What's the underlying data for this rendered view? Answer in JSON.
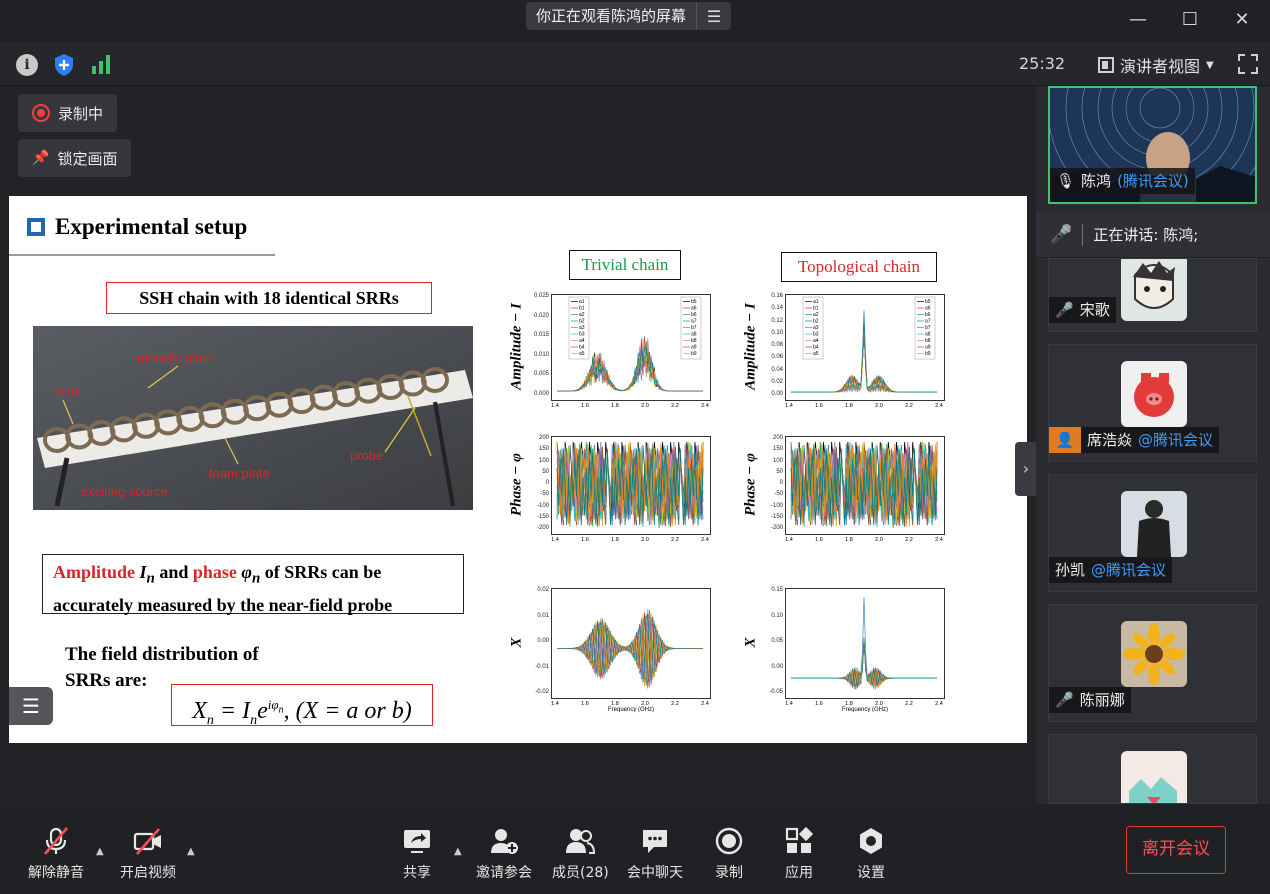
{
  "titlebar": {
    "share_status": "你正在观看陈鸿的屏幕",
    "menu_icon": "list-icon"
  },
  "statusbar": {
    "timer": "25:32",
    "view_mode": "演讲者视图"
  },
  "stage": {
    "recording_label": "录制中",
    "lock_label": "锁定画面"
  },
  "slide": {
    "title": "Experimental setup",
    "ssh_label": "SSH chain with 18 identical SRRs",
    "photo_labels": {
      "srr": "SRR",
      "metallic_plate": "metallic plate",
      "foam_plate": "foam plate",
      "probe": "probe",
      "exciting_source": "exciting source"
    },
    "measure_text": {
      "amplitude": "Amplitude",
      "amp_sym": "I",
      "amp_sub": "n",
      "and": " and ",
      "phase": "phase",
      "phase_sym": "φ",
      "phase_sub": "n",
      "rest1": " of SRRs can be",
      "rest2": "accurately measured by the near-field probe"
    },
    "field_text_1": "The field distribution of",
    "field_text_2": "SRRs are:",
    "equation": "Xn = Ineiφn, (X = a or b)",
    "trivial_label": "Trivial chain",
    "topological_label": "Topological chain",
    "y_labels": [
      "Amplitude − I",
      "Phase − φ",
      "X"
    ],
    "x_label": "Frequency (GHz)",
    "x_ticks": [
      "1.4",
      "1.6",
      "1.8",
      "2.0",
      "2.2",
      "2.4"
    ],
    "trivial_amp_ticks": [
      "0.025",
      "0.020",
      "0.015",
      "0.010",
      "0.005",
      "0.000"
    ],
    "topo_amp_ticks": [
      "0.16",
      "0.14",
      "0.12",
      "0.10",
      "0.08",
      "0.06",
      "0.04",
      "0.02",
      "0.00"
    ],
    "phase_ticks": [
      "200",
      "150",
      "100",
      "50",
      "0",
      "-50",
      "-100",
      "-150",
      "-200"
    ],
    "trivial_x_ticks": [
      "0.02",
      "0.01",
      "0.00",
      "-0.01",
      "-0.02"
    ],
    "topo_x_ticks": [
      "0.15",
      "0.10",
      "0.05",
      "0.00",
      "-0.05"
    ],
    "legend_left": [
      "a1",
      "b1",
      "a2",
      "b2",
      "a3",
      "b3",
      "a4",
      "b4",
      "a5"
    ],
    "legend_right_trivial": [
      "b5",
      "a6",
      "b6",
      "a7",
      "b7",
      "a8",
      "b8",
      "a9",
      "b9"
    ],
    "legend_right_topo": [
      "b5",
      "a6",
      "b6",
      "a7",
      "b7",
      "a8",
      "b8",
      "a9",
      "b9"
    ]
  },
  "participants": [
    {
      "name": "陈鸿",
      "suffix": "(腾讯会议)",
      "muted": false
    },
    {
      "name": "宋歌",
      "suffix": "",
      "muted": true
    },
    {
      "name": "席浩焱",
      "suffix": "@腾讯会议",
      "muted": false
    },
    {
      "name": "孙凯",
      "suffix": "@腾讯会议",
      "muted": false
    },
    {
      "name": "陈丽娜",
      "suffix": "",
      "muted": true
    },
    {
      "name": "",
      "suffix": "",
      "muted": false
    }
  ],
  "speaking": "正在讲话: 陈鸿;",
  "toolbar": {
    "unmute": "解除静音",
    "video": "开启视频",
    "share": "共享",
    "invite": "邀请参会",
    "members": "成员(28)",
    "chat": "会中聊天",
    "record": "录制",
    "apps": "应用",
    "settings": "设置",
    "leave": "离开会议"
  }
}
